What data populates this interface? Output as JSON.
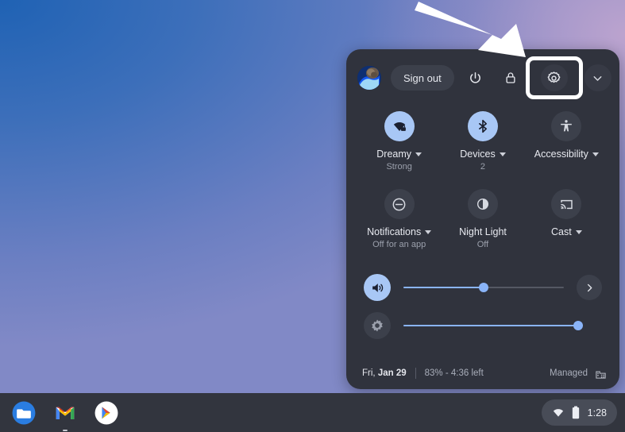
{
  "desktop": {
    "wallpaper_colors": [
      "#2b6cb8",
      "#4a72bb",
      "#7b89c4",
      "#c6a8d0"
    ]
  },
  "annotation": {
    "arrow_name": "pointer-arrow",
    "arrow_color": "#ffffff",
    "highlight_color": "#ffffff",
    "highlight_target": "settings-button"
  },
  "quick_settings": {
    "top_row": {
      "avatar_label": "User avatar",
      "sign_out_label": "Sign out",
      "power_icon": "power-icon",
      "lock_icon": "lock-icon",
      "settings_icon": "gear-icon",
      "collapse_icon": "chevron-down-icon"
    },
    "tiles": [
      {
        "id": "network",
        "label": "Dreamy",
        "sublabel": "Strong",
        "icon": "wifi-locked-icon",
        "state": "on",
        "has_caret": true
      },
      {
        "id": "bluetooth",
        "label": "Devices",
        "sublabel": "2",
        "icon": "bluetooth-icon",
        "state": "on",
        "has_caret": true
      },
      {
        "id": "accessibility",
        "label": "Accessibility",
        "sublabel": "",
        "icon": "accessibility-icon",
        "state": "off",
        "has_caret": true
      },
      {
        "id": "notifications",
        "label": "Notifications",
        "sublabel": "Off for an app",
        "icon": "do-not-disturb-icon",
        "state": "off",
        "has_caret": true
      },
      {
        "id": "night-light",
        "label": "Night Light",
        "sublabel": "Off",
        "icon": "night-light-icon",
        "state": "off",
        "has_caret": false
      },
      {
        "id": "cast",
        "label": "Cast",
        "sublabel": "",
        "icon": "cast-icon",
        "state": "off",
        "has_caret": true
      }
    ],
    "sliders": [
      {
        "id": "volume",
        "icon": "volume-up-icon",
        "state": "on",
        "percent": 50,
        "trailing_icon": "chevron-right-icon"
      },
      {
        "id": "brightness",
        "icon": "brightness-icon",
        "state": "off",
        "percent": 100,
        "trailing_icon": ""
      }
    ],
    "footer": {
      "date_prefix": "Fri, ",
      "date_main": "Jan 29",
      "battery": "83% - 4:36 left",
      "managed_label": "Managed",
      "enterprise_icon": "enterprise-building-icon"
    }
  },
  "shelf": {
    "apps": [
      {
        "id": "files",
        "name": "Files",
        "icon": "files-folder-icon",
        "running": false
      },
      {
        "id": "gmail",
        "name": "Gmail",
        "icon": "gmail-icon",
        "running": true
      },
      {
        "id": "play-store",
        "name": "Play Store",
        "icon": "play-store-icon",
        "running": false
      }
    ],
    "status_tray": {
      "network_icon": "wifi-icon",
      "battery_icon": "battery-icon",
      "time": "1:28"
    }
  }
}
